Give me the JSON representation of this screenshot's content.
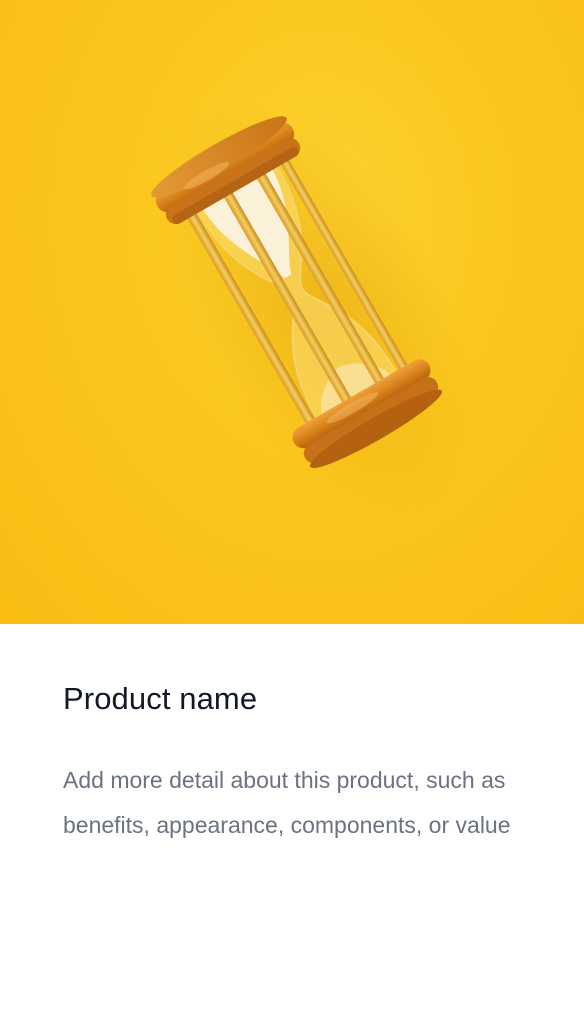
{
  "product": {
    "image_subject": "hourglass-photo",
    "title": "Product name",
    "description": "Add more detail about this product, such as benefits, appearance, components, or value"
  },
  "colors": {
    "image_background": "#fbc61c",
    "title_text": "#111827",
    "description_text": "#6b7280"
  }
}
